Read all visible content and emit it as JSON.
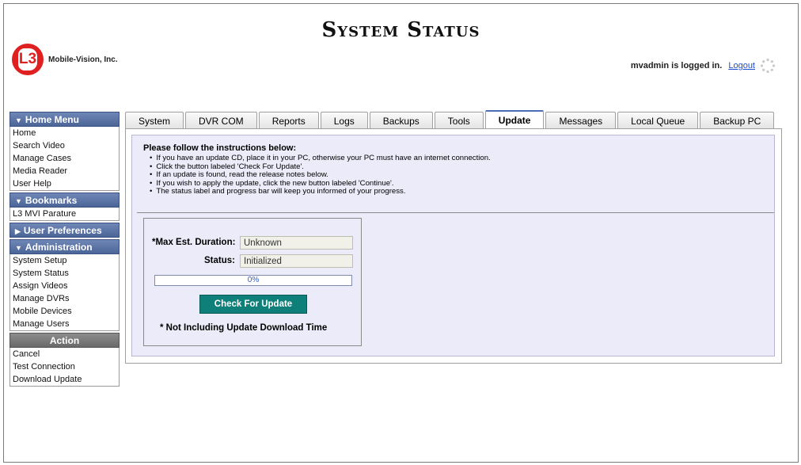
{
  "header": {
    "title": "System Status",
    "logo_mark": "L3",
    "logo_text": "Mobile-Vision, Inc.",
    "user_status": "mvadmin is logged in.",
    "logout_label": "Logout"
  },
  "sidebar": {
    "sections": [
      {
        "title": "Home Menu",
        "expanded": true,
        "items": [
          "Home",
          "Search Video",
          "Manage Cases",
          "Media Reader",
          "User Help"
        ]
      },
      {
        "title": "Bookmarks",
        "expanded": true,
        "items": [
          "L3 MVI Parature"
        ]
      },
      {
        "title": "User Preferences",
        "expanded": false,
        "items": []
      },
      {
        "title": "Administration",
        "expanded": true,
        "items": [
          "System Setup",
          "System Status",
          "Assign Videos",
          "Manage DVRs",
          "Mobile Devices",
          "Manage Users"
        ]
      }
    ],
    "action": {
      "title": "Action",
      "items": [
        "Cancel",
        "Test Connection",
        "Download Update"
      ]
    }
  },
  "tabs": [
    "System",
    "DVR COM",
    "Reports",
    "Logs",
    "Backups",
    "Tools",
    "Update",
    "Messages",
    "Local Queue",
    "Backup PC"
  ],
  "active_tab": "Update",
  "instructions": {
    "heading": "Please follow the instructions below:",
    "items": [
      "If you have an update CD, place it in your PC, otherwise your PC must have an internet connection.",
      "Click the button labeled 'Check For Update'.",
      "If an update is found, read the release notes below.",
      "If you wish to apply the update, click the new button labeled 'Continue'.",
      "The status label and progress bar will keep you informed of your progress."
    ]
  },
  "update": {
    "duration_label": "*Max Est. Duration:",
    "duration_value": "Unknown",
    "status_label": "Status:",
    "status_value": "Initialized",
    "progress_text": "0%",
    "progress_fraction": 0,
    "button_label": "Check For Update",
    "note": "* Not Including Update Download Time"
  },
  "colors": {
    "sidebar_header": "#5a71a5",
    "button": "#0f7f7a",
    "panel_bg": "#ebebfa",
    "logo_red": "#e02020",
    "link": "#1a4fd1"
  }
}
